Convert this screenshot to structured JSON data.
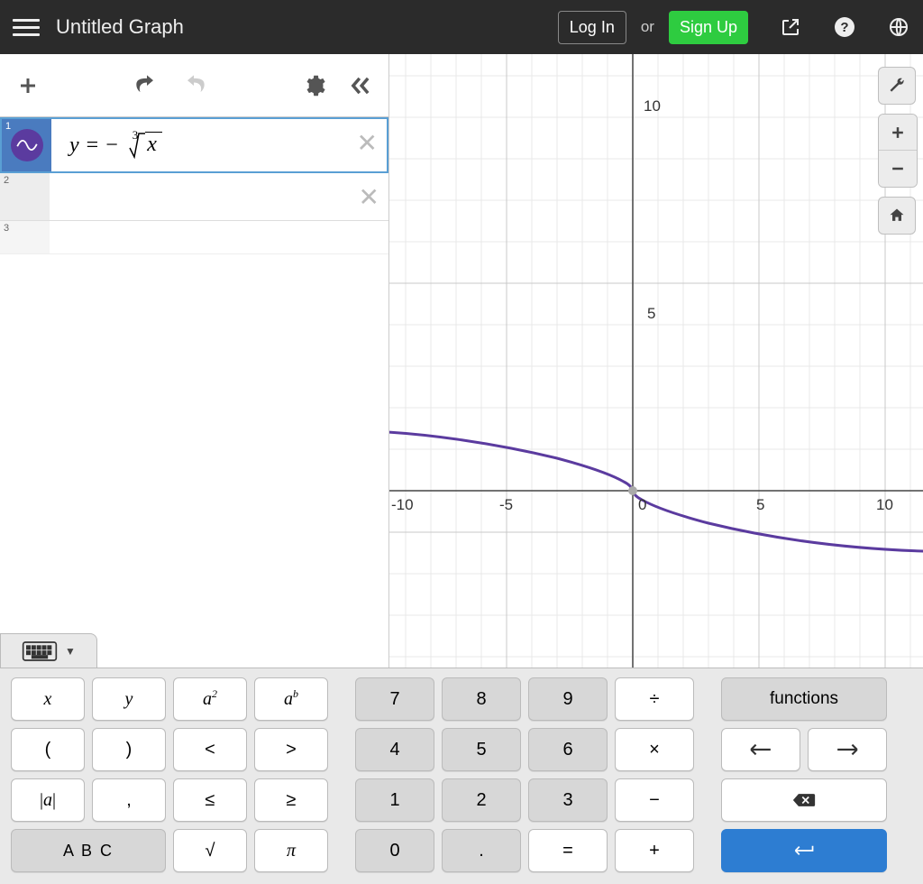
{
  "header": {
    "title": "Untitled Graph",
    "login": "Log In",
    "or": "or",
    "signup": "Sign Up"
  },
  "expressions": {
    "row1": {
      "index": "1",
      "var": "y",
      "eq": "=",
      "neg": "−",
      "root_index": "3",
      "radicand": "x"
    },
    "row2": {
      "index": "2"
    },
    "row3": {
      "index": "3"
    }
  },
  "axis": {
    "x_ticks": {
      "m10": "-10",
      "m5": "-5",
      "z": "0",
      "p5": "5",
      "p10": "10"
    },
    "y_ticks": {
      "p10": "10",
      "p5": "5"
    }
  },
  "chart_data": {
    "type": "line",
    "title": "",
    "xlabel": "",
    "ylabel": "",
    "xlim": [
      -10.5,
      10.5
    ],
    "ylim": [
      -4,
      11
    ],
    "grid": true,
    "series": [
      {
        "name": "y = -∛x",
        "color": "#5b3b9f",
        "x": [
          -10,
          -8,
          -6,
          -5,
          -4,
          -3,
          -2,
          -1,
          -0.5,
          -0.125,
          0,
          0.125,
          0.5,
          1,
          2,
          3,
          4,
          5,
          6,
          8,
          10
        ],
        "y": [
          2.154,
          2.0,
          1.817,
          1.71,
          1.587,
          1.442,
          1.26,
          1.0,
          0.794,
          0.5,
          0,
          -0.5,
          -0.794,
          -1.0,
          -1.26,
          -1.442,
          -1.587,
          -1.71,
          -1.817,
          -2.0,
          -2.154
        ]
      }
    ]
  },
  "keys": {
    "x": "x",
    "y": "y",
    "a2": "a",
    "a2sup": "2",
    "ab": "a",
    "absup": "b",
    "lp": "(",
    "rp": ")",
    "lt": "<",
    "gt": ">",
    "abs": "|a|",
    "comma": ",",
    "le": "≤",
    "ge": "≥",
    "abc": "A B C",
    "sqrt": "√",
    "pi": "π",
    "7": "7",
    "8": "8",
    "9": "9",
    "div": "÷",
    "4": "4",
    "5": "5",
    "6": "6",
    "mul": "×",
    "1": "1",
    "2": "2",
    "3": "3",
    "sub": "−",
    "0": "0",
    "dot": ".",
    "equ": "=",
    "add": "+",
    "functions": "functions"
  }
}
